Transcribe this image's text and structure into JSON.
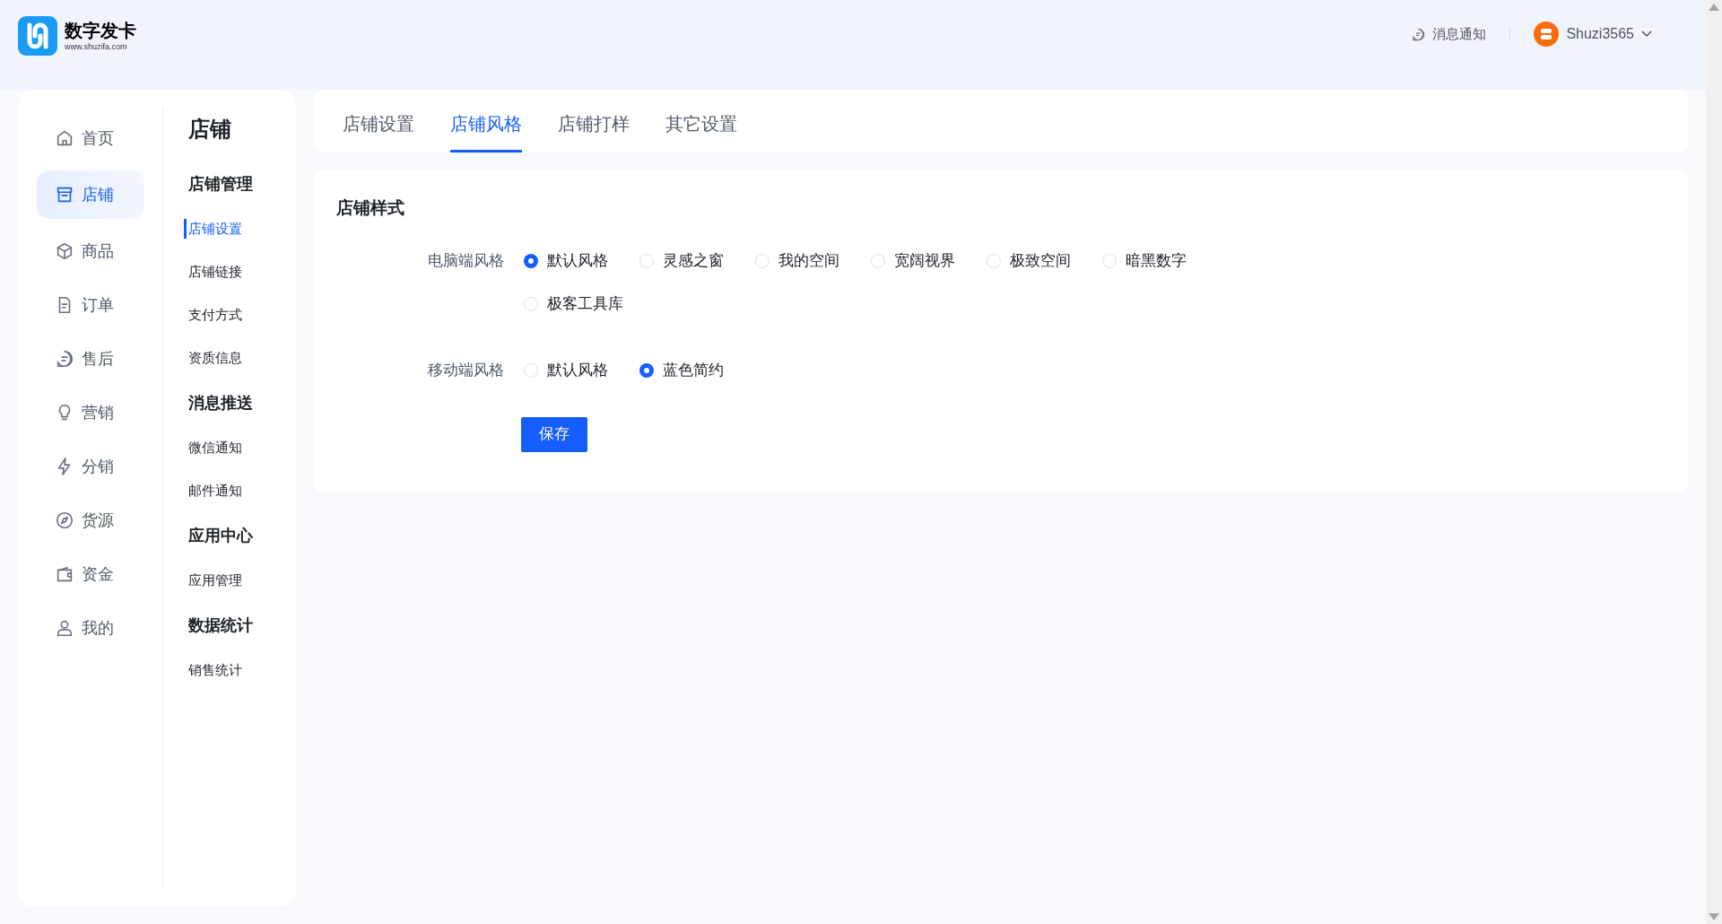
{
  "logo": {
    "name": "数字发卡",
    "url": "www.shuzifa.com"
  },
  "header": {
    "notifications": "消息通知",
    "username": "Shuzi3565"
  },
  "nav": [
    {
      "label": "首页",
      "selected": false
    },
    {
      "label": "店铺",
      "selected": true
    },
    {
      "label": "商品",
      "selected": false
    },
    {
      "label": "订单",
      "selected": false
    },
    {
      "label": "售后",
      "selected": false
    },
    {
      "label": "营销",
      "selected": false
    },
    {
      "label": "分销",
      "selected": false
    },
    {
      "label": "货源",
      "selected": false
    },
    {
      "label": "资金",
      "selected": false
    },
    {
      "label": "我的",
      "selected": false
    }
  ],
  "submenu": {
    "title": "店铺",
    "groups": [
      {
        "title": "店铺管理",
        "items": [
          {
            "label": "店铺设置",
            "selected": true
          },
          {
            "label": "店铺链接",
            "selected": false
          },
          {
            "label": "支付方式",
            "selected": false
          },
          {
            "label": "资质信息",
            "selected": false
          }
        ]
      },
      {
        "title": "消息推送",
        "items": [
          {
            "label": "微信通知",
            "selected": false
          },
          {
            "label": "邮件通知",
            "selected": false
          }
        ]
      },
      {
        "title": "应用中心",
        "items": [
          {
            "label": "应用管理",
            "selected": false
          }
        ]
      },
      {
        "title": "数据统计",
        "items": [
          {
            "label": "销售统计",
            "selected": false
          }
        ]
      }
    ]
  },
  "tabs": [
    {
      "label": "店铺设置",
      "selected": false
    },
    {
      "label": "店铺风格",
      "selected": true
    },
    {
      "label": "店铺打样",
      "selected": false
    },
    {
      "label": "其它设置",
      "selected": false
    }
  ],
  "form": {
    "title": "店铺样式",
    "fields": [
      {
        "label": "电脑端风格",
        "options": [
          {
            "label": "默认风格",
            "selected": true
          },
          {
            "label": "灵感之窗",
            "selected": false
          },
          {
            "label": "我的空间",
            "selected": false
          },
          {
            "label": "宽阔视界",
            "selected": false
          },
          {
            "label": "极致空间",
            "selected": false
          },
          {
            "label": "暗黑数字",
            "selected": false
          },
          {
            "label": "极客工具库",
            "selected": false
          }
        ]
      },
      {
        "label": "移动端风格",
        "options": [
          {
            "label": "默认风格",
            "selected": false
          },
          {
            "label": "蓝色简约",
            "selected": true
          }
        ]
      }
    ],
    "save": "保存"
  }
}
